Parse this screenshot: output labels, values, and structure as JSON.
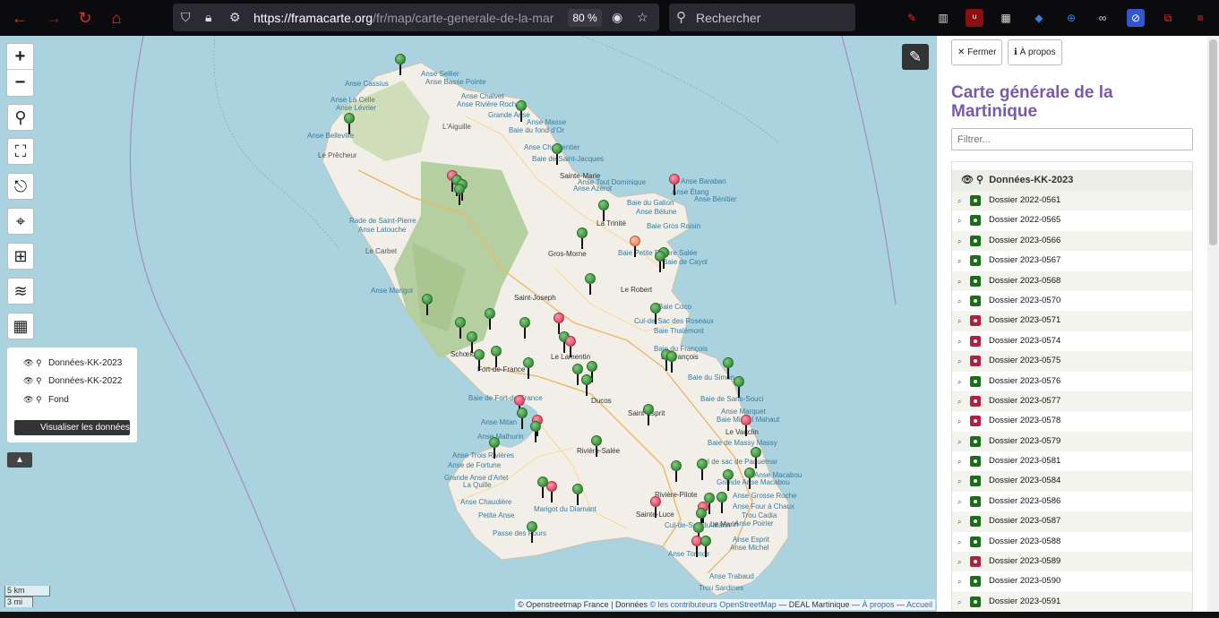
{
  "browser": {
    "url_domain": "https://framacarte.org",
    "url_path": "/fr/map/carte-generale-de-la-mar",
    "zoom": "80 %",
    "search_placeholder": "Rechercher"
  },
  "map": {
    "zoom_in": "+",
    "zoom_out": "−",
    "layers_panel": {
      "items": [
        "Données-KK-2023",
        "Données-KK-2022",
        "Fond"
      ],
      "visualize_button": "Visualiser les données"
    },
    "scale": {
      "km": "5 km",
      "mi": "3 mi"
    },
    "attribution": {
      "part1": "© Openstreetmap France | Données ",
      "link1": "© les contributeurs OpenStreetMap",
      "part2": " — DEAL Martinique — ",
      "link2": "À propos",
      "sep": " — ",
      "link3": "Accueil"
    },
    "labels": [
      "Anse Sellier",
      "Anse Basse Pointe",
      "Anse Cassius",
      "Anse La Celle",
      "Anse Lévrier",
      "Anse Chalvet",
      "Anse Rivière Roche",
      "Grande Anse",
      "Anse Masse",
      "Baie du fond d'Or",
      "L'Aiguille",
      "Anse Belleville",
      "Le Prêcheur",
      "Anse Charpentier",
      "Baie de Saint-Jacques",
      "Sainte-Marie",
      "Anse Azérot",
      "Anse Tout Dominique",
      "Anse Baraban",
      "Anse Bénitier",
      "Anse Étang",
      "Baie du Galion",
      "Anse Bélune",
      "La Trinité",
      "Baie Gros Raisin",
      "Rade de Saint-Pierre",
      "Anse Latouche",
      "Le Carbet",
      "Gros-Morne",
      "Baie de Cayol",
      "Baie Petite Rivière Salée",
      "Anse Marigot",
      "Saint-Joseph",
      "Le Robert",
      "Baie Coco",
      "Cul-de-Sac des Roseaux",
      "Baie Thalémont",
      "Baie du François",
      "Le François",
      "Schœlcher",
      "Fort-de-France",
      "Le Lamentin",
      "Baie de Fort-de-France",
      "Baie du Simon",
      "Baie de Sans-Souci",
      "Anse Marquet",
      "Baie Michel Mahaut",
      "Le Vauclin",
      "Ducos",
      "Saint-Esprit",
      "Baie de Massy Massy",
      "Anse Mitan",
      "Anse Mathurin",
      "Anse Trois Rivières",
      "Anse de Fortune",
      "Rivière-Salée",
      "Cul de sac de Paquemar",
      "Anse Macabou",
      "Grande Anse Macabou",
      "Grande Anse d'Arlet",
      "La Quille",
      "Anse Chaudière",
      "Petite Anse",
      "Marigot du Diamant",
      "Rivière-Pilote",
      "Anse Grosse Roche",
      "Anse Four à Chaux",
      "Trou Cadia",
      "Anse Poirier",
      "Sainte-Luce",
      "Cul-de-Sac du Marin",
      "Passe des Fours",
      "Anse Esprit",
      "Anse Michel",
      "Anse Trabaud",
      "Trou Sardines",
      "Anse Tonnoir",
      "Le Marin"
    ]
  },
  "panel": {
    "close_button": "Fermer",
    "about_button": "À propos",
    "title": "Carte générale de la Martinique",
    "filter_placeholder": "Filtrer...",
    "layer_title": "Données-KK-2023",
    "items": [
      {
        "label": "Dossier 2022-0561",
        "color": "#1a6e1a"
      },
      {
        "label": "Dossier 2022-0565",
        "color": "#1a6e1a"
      },
      {
        "label": "Dossier 2023-0566",
        "color": "#1a6e1a"
      },
      {
        "label": "Dossier 2023-0567",
        "color": "#1a6e1a"
      },
      {
        "label": "Dossier 2023-0568",
        "color": "#1a6e1a"
      },
      {
        "label": "Dossier 2023-0570",
        "color": "#1a6e1a"
      },
      {
        "label": "Dossier 2023-0571",
        "color": "#b02040"
      },
      {
        "label": "Dossier 2023-0574",
        "color": "#b02040"
      },
      {
        "label": "Dossier 2023-0575",
        "color": "#b02040"
      },
      {
        "label": "Dossier 2023-0576",
        "color": "#1a6e1a"
      },
      {
        "label": "Dossier 2023-0577",
        "color": "#b02040"
      },
      {
        "label": "Dossier 2023-0578",
        "color": "#b02040"
      },
      {
        "label": "Dossier 2023-0579",
        "color": "#1a6e1a"
      },
      {
        "label": "Dossier 2023-0581",
        "color": "#1a6e1a"
      },
      {
        "label": "Dossier 2023-0584",
        "color": "#1a6e1a"
      },
      {
        "label": "Dossier 2023-0586",
        "color": "#1a6e1a"
      },
      {
        "label": "Dossier 2023-0587",
        "color": "#1a6e1a"
      },
      {
        "label": "Dossier 2023-0588",
        "color": "#1a6e1a"
      },
      {
        "label": "Dossier 2023-0589",
        "color": "#b02040"
      },
      {
        "label": "Dossier 2023-0590",
        "color": "#1a6e1a"
      },
      {
        "label": "Dossier 2023-0591",
        "color": "#1a6e1a"
      }
    ]
  },
  "colors": {
    "title": "#7a5aa8",
    "marker_green": "#1f7a1f",
    "marker_red": "#d8264a",
    "sea": "#aad3df",
    "land": "#f2efe9"
  }
}
